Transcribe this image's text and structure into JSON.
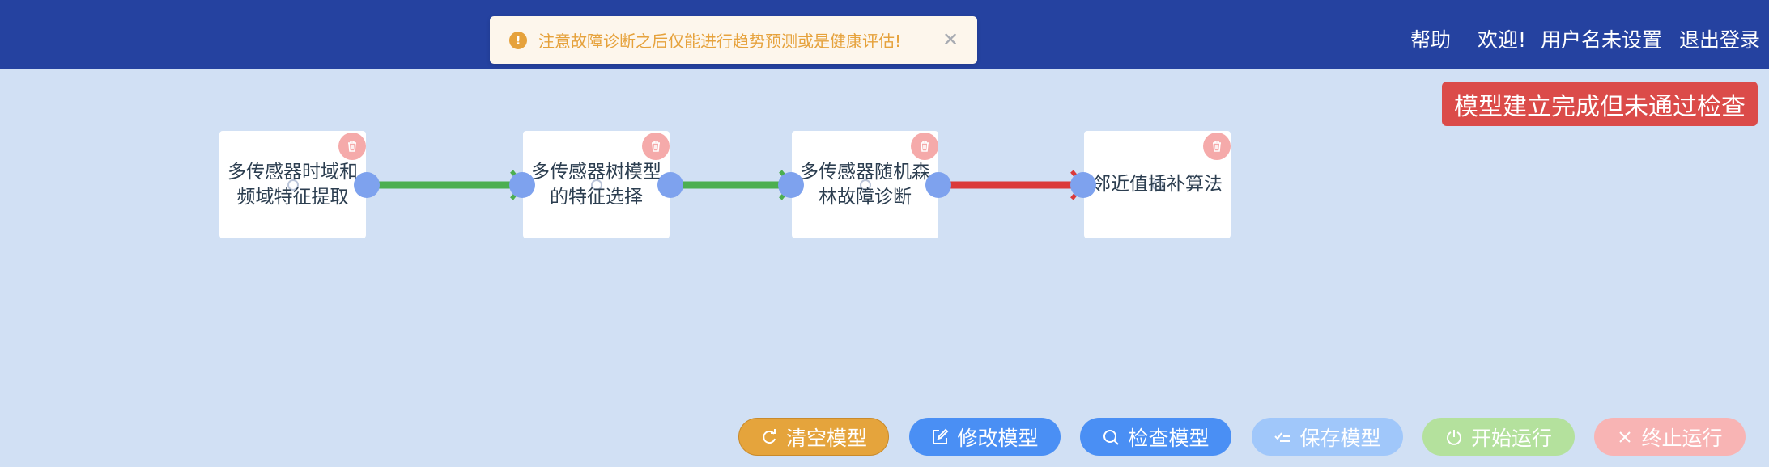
{
  "header": {
    "help_label": "帮助",
    "welcome_label": "欢迎!",
    "username_label": "用户名未设置",
    "logout_label": "退出登录"
  },
  "toast": {
    "message": "注意故障诊断之后仅能进行趋势预测或是健康评估!",
    "warn_glyph": "!",
    "close_glyph": "✕"
  },
  "status": {
    "text": "模型建立完成但未通过检查"
  },
  "nodes": [
    {
      "label": "多传感器时域和频域特征提取"
    },
    {
      "label": "多传感器树模型的特征选择"
    },
    {
      "label": "多传感器随机森林故障诊断"
    },
    {
      "label": "邻近值插补算法"
    }
  ],
  "links": [
    {
      "from": 0,
      "to": 1,
      "status": "valid"
    },
    {
      "from": 1,
      "to": 2,
      "status": "valid"
    },
    {
      "from": 2,
      "to": 3,
      "status": "invalid"
    }
  ],
  "colors": {
    "header_bg": "#2542a0",
    "canvas_bg": "#d1e0f4",
    "link_valid": "#4caf50",
    "link_invalid": "#db3a3a",
    "status_badge": "#db4b49"
  },
  "toolbar": {
    "clear_label": "清空模型",
    "edit_label": "修改模型",
    "check_label": "检查模型",
    "save_label": "保存模型",
    "start_label": "开始运行",
    "stop_label": "终止运行"
  }
}
